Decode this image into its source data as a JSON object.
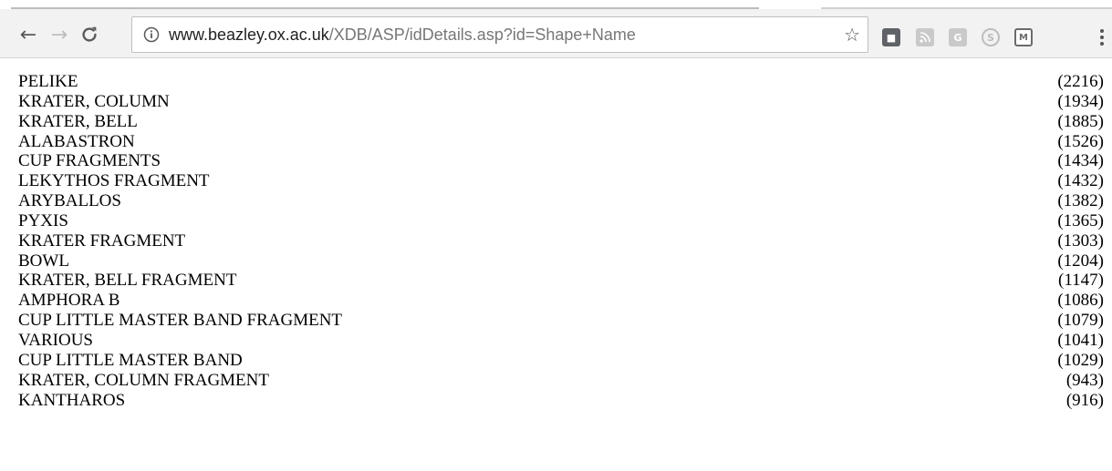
{
  "browser": {
    "address_bar": {
      "host": "www.beazley.ox.ac.uk",
      "path": "/XDB/ASP/idDetails.asp?id=Shape+Name"
    },
    "extension_icons": [
      "reading-list-icon",
      "rss-icon",
      "grammarly-icon",
      "skype-icon",
      "mendeley-icon"
    ]
  },
  "shapes": [
    {
      "name": "PELIKE",
      "count": "(2216)"
    },
    {
      "name": "KRATER, COLUMN",
      "count": "(1934)"
    },
    {
      "name": "KRATER, BELL",
      "count": "(1885)"
    },
    {
      "name": "ALABASTRON",
      "count": "(1526)"
    },
    {
      "name": "CUP FRAGMENTS",
      "count": "(1434)"
    },
    {
      "name": "LEKYTHOS FRAGMENT",
      "count": "(1432)"
    },
    {
      "name": "ARYBALLOS",
      "count": "(1382)"
    },
    {
      "name": "PYXIS",
      "count": "(1365)"
    },
    {
      "name": "KRATER FRAGMENT",
      "count": "(1303)"
    },
    {
      "name": "BOWL",
      "count": "(1204)"
    },
    {
      "name": "KRATER, BELL FRAGMENT",
      "count": "(1147)"
    },
    {
      "name": "AMPHORA B",
      "count": "(1086)"
    },
    {
      "name": "CUP LITTLE MASTER BAND FRAGMENT",
      "count": "(1079)"
    },
    {
      "name": "VARIOUS",
      "count": "(1041)"
    },
    {
      "name": "CUP LITTLE MASTER BAND",
      "count": "(1029)"
    },
    {
      "name": "KRATER, COLUMN FRAGMENT",
      "count": "(943)"
    },
    {
      "name": "KANTHAROS",
      "count": "(916)"
    }
  ]
}
